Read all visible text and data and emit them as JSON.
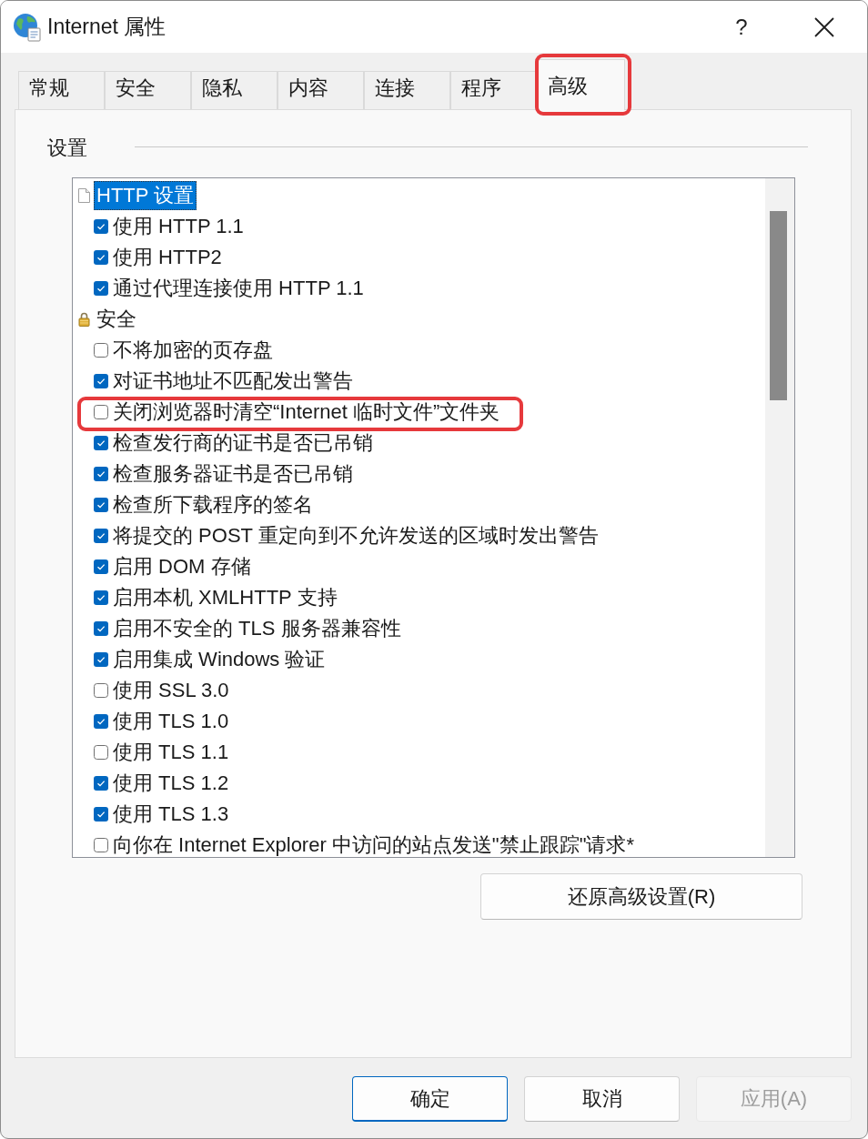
{
  "window": {
    "title": "Internet 属性",
    "help_button": "?"
  },
  "tabs": [
    {
      "label": "常规",
      "selected": false,
      "highlighted": false
    },
    {
      "label": "安全",
      "selected": false,
      "highlighted": false
    },
    {
      "label": "隐私",
      "selected": false,
      "highlighted": false
    },
    {
      "label": "内容",
      "selected": false,
      "highlighted": false
    },
    {
      "label": "连接",
      "selected": false,
      "highlighted": false
    },
    {
      "label": "程序",
      "selected": false,
      "highlighted": false
    },
    {
      "label": "高级",
      "selected": true,
      "highlighted": true
    }
  ],
  "settings": {
    "title": "设置",
    "categories": [
      {
        "label": "HTTP 设置",
        "selected": true,
        "children": [
          {
            "label": "使用 HTTP 1.1",
            "checked": true,
            "highlighted": false
          },
          {
            "label": "使用 HTTP2",
            "checked": true,
            "highlighted": false
          },
          {
            "label": "通过代理连接使用 HTTP 1.1",
            "checked": true,
            "highlighted": false
          }
        ]
      },
      {
        "label": "安全",
        "selected": false,
        "children": [
          {
            "label": "不将加密的页存盘",
            "checked": false,
            "highlighted": false
          },
          {
            "label": "对证书地址不匹配发出警告",
            "checked": true,
            "highlighted": false
          },
          {
            "label": "关闭浏览器时清空“Internet 临时文件”文件夹",
            "checked": false,
            "highlighted": true
          },
          {
            "label": "检查发行商的证书是否已吊销",
            "checked": true,
            "highlighted": false
          },
          {
            "label": "检查服务器证书是否已吊销",
            "checked": true,
            "highlighted": false
          },
          {
            "label": "检查所下载程序的签名",
            "checked": true,
            "highlighted": false
          },
          {
            "label": "将提交的 POST 重定向到不允许发送的区域时发出警告",
            "checked": true,
            "highlighted": false
          },
          {
            "label": "启用 DOM 存储",
            "checked": true,
            "highlighted": false
          },
          {
            "label": "启用本机 XMLHTTP 支持",
            "checked": true,
            "highlighted": false
          },
          {
            "label": "启用不安全的 TLS 服务器兼容性",
            "checked": true,
            "highlighted": false
          },
          {
            "label": "启用集成 Windows 验证",
            "checked": true,
            "highlighted": false
          },
          {
            "label": "使用 SSL 3.0",
            "checked": false,
            "highlighted": false
          },
          {
            "label": "使用 TLS 1.0",
            "checked": true,
            "highlighted": false
          },
          {
            "label": "使用 TLS 1.1",
            "checked": false,
            "highlighted": false
          },
          {
            "label": "使用 TLS 1.2",
            "checked": true,
            "highlighted": false
          },
          {
            "label": "使用 TLS 1.3",
            "checked": true,
            "highlighted": false
          },
          {
            "label": "向你在 Internet Explorer 中访问的站点发送\"禁止跟踪\"请求*",
            "checked": false,
            "highlighted": false
          }
        ]
      }
    ]
  },
  "restore_button": "还原高级设置(R)",
  "footer_buttons": [
    {
      "label": "确定",
      "default": true,
      "disabled": false
    },
    {
      "label": "取消",
      "default": false,
      "disabled": false
    },
    {
      "label": "应用(A)",
      "default": false,
      "disabled": true
    }
  ]
}
